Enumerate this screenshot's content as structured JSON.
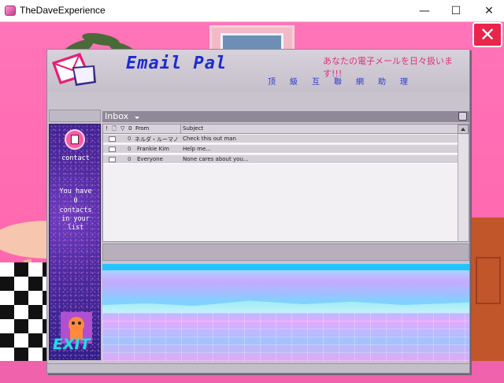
{
  "window": {
    "title": "TheDaveExperience",
    "minimize_glyph": "—",
    "maximize_glyph": "☐",
    "close_glyph": "✕"
  },
  "scene": {
    "close_glyph": "✕"
  },
  "app": {
    "title": "Email Pal",
    "tagline": "あなたの電子メールを日々扱います!!!",
    "subtitle_chars": [
      "顶",
      "級",
      "互",
      "聯",
      "網",
      "助",
      "理"
    ]
  },
  "sidebar": {
    "contact_label": "contact",
    "contacts_line1": "You have",
    "contacts_count": "0",
    "contacts_line2": "contacts",
    "contacts_line3": "in your",
    "contacts_line4": "list",
    "exit_label": "EXIT"
  },
  "inbox": {
    "folder_label": "Inbox",
    "columns": {
      "priority": "!",
      "doc": "🗋",
      "flag": "▽",
      "attach": "0",
      "from": "From",
      "subject": "Subject"
    },
    "rows": [
      {
        "from": "ネルダ・ルーマノ",
        "subject": "Check this out man"
      },
      {
        "from": "Frankie Kim",
        "subject": "Help me..."
      },
      {
        "from": "Everyone",
        "subject": "None cares about you..."
      }
    ],
    "attach_glyph": "0"
  },
  "colors": {
    "background_pink": "#ff6fb0",
    "title_blue": "#1c2bd3",
    "tagline_pink": "#e0307a",
    "exit_cyan": "#18e0e8"
  }
}
